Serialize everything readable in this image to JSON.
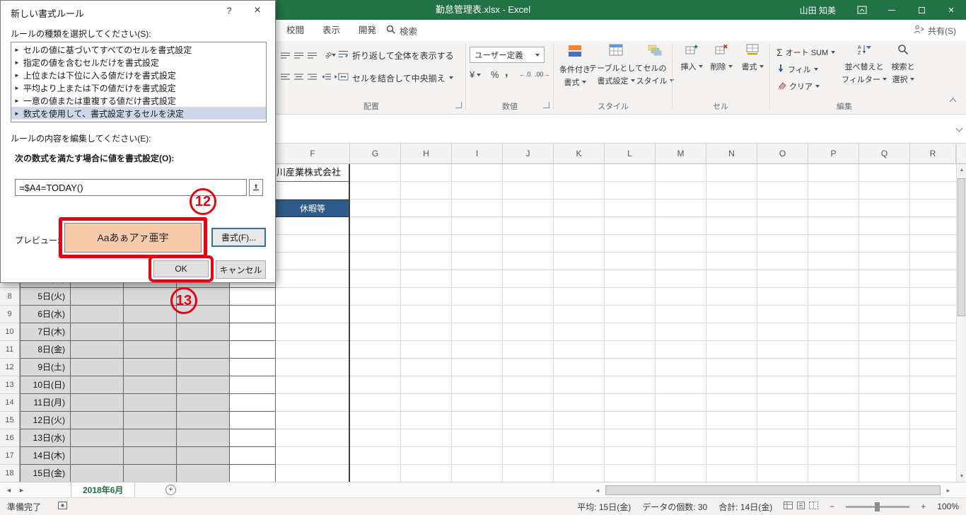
{
  "title_bar": {
    "title": "勤怠管理表.xlsx - Excel",
    "user": "山田 知美",
    "share_label": "共有(S)"
  },
  "ribbon_tabs": {
    "review": "校閲",
    "view": "表示",
    "developer": "開発",
    "search": "検索"
  },
  "ribbon": {
    "alignment": {
      "label": "配置",
      "wrap_text": "折り返して全体を表示する",
      "merge_center": "セルを結合して中央揃え"
    },
    "number": {
      "label": "数値",
      "format_selected": "ユーザー定義"
    },
    "styles": {
      "label": "スタイル",
      "conditional_line1": "条件付き",
      "conditional_line2": "書式",
      "table_line1": "テーブルとして",
      "table_line2": "書式設定",
      "cellstyles_line1": "セルの",
      "cellstyles_line2": "スタイル"
    },
    "cells": {
      "label": "セル",
      "insert": "挿入",
      "delete": "削除",
      "format": "書式"
    },
    "editing": {
      "label": "編集",
      "autosum": "オート SUM",
      "fill": "フィル",
      "clear": "クリア",
      "sort_line1": "並べ替えと",
      "sort_line2": "フィルター",
      "find_line1": "検索と",
      "find_line2": "選択"
    }
  },
  "dialog": {
    "title": "新しい書式ルール",
    "rule_type_label": "ルールの種類を選択してください(S):",
    "rule_types": [
      "セルの値に基づいてすべてのセルを書式設定",
      "指定の値を含むセルだけを書式設定",
      "上位または下位に入る値だけを書式設定",
      "平均より上または下の値だけを書式設定",
      "一意の値または重複する値だけ書式設定",
      "数式を使用して、書式設定するセルを決定"
    ],
    "edit_label": "ルールの内容を編集してください(E):",
    "formula_label": "次の数式を満たす場合に値を書式設定(O):",
    "formula_value": "=$A4=TODAY()",
    "preview_label": "プレビュー:",
    "preview_text": "Aaあぁアァ亜宇",
    "format_button": "書式(F)...",
    "ok_button": "OK",
    "cancel_button": "キャンセル"
  },
  "annotations": {
    "step12": "12",
    "step13": "13"
  },
  "grid": {
    "company": "川産業株式会社",
    "vacation_header": "休暇等",
    "columns": [
      "F",
      "G",
      "H",
      "I",
      "J",
      "K",
      "L",
      "M",
      "N",
      "O",
      "P",
      "Q",
      "R"
    ],
    "rows": [
      {
        "num": "7",
        "date": "4日(月)"
      },
      {
        "num": "8",
        "date": "5日(火)"
      },
      {
        "num": "9",
        "date": "6日(水)"
      },
      {
        "num": "10",
        "date": "7日(木)"
      },
      {
        "num": "11",
        "date": "8日(金)"
      },
      {
        "num": "12",
        "date": "9日(土)"
      },
      {
        "num": "13",
        "date": "10日(日)"
      },
      {
        "num": "14",
        "date": "11日(月)"
      },
      {
        "num": "15",
        "date": "12日(火)"
      },
      {
        "num": "16",
        "date": "13日(水)"
      },
      {
        "num": "17",
        "date": "14日(木)"
      },
      {
        "num": "18",
        "date": "15日(金)"
      }
    ]
  },
  "sheet_bar": {
    "active_tab": "2018年6月"
  },
  "status_bar": {
    "ready": "準備完了",
    "average": "平均: 15日(金)",
    "count": "データの個数: 30",
    "sum": "合計: 14日(金)",
    "zoom": "100%"
  },
  "colors": {
    "excel_green": "#217346",
    "annotation_red": "#e60012",
    "header_blue": "#2e5c8a",
    "preview_fill": "#f8cbad"
  }
}
